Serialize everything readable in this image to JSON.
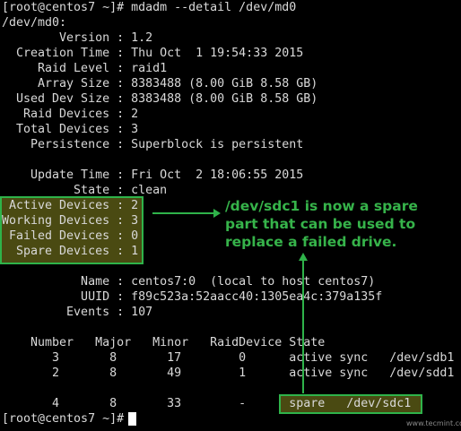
{
  "terminal": {
    "command_line": "[root@centos7 ~]# mdadm --detail /dev/md0",
    "device_line": "/dev/md0:",
    "details": [
      "        Version : 1.2",
      "  Creation Time : Thu Oct  1 19:54:33 2015",
      "     Raid Level : raid1",
      "     Array Size : 8383488 (8.00 GiB 8.58 GB)",
      "  Used Dev Size : 8383488 (8.00 GiB 8.58 GB)",
      "   Raid Devices : 2",
      "  Total Devices : 3",
      "    Persistence : Superblock is persistent",
      "",
      "    Update Time : Fri Oct  2 18:06:55 2015",
      "          State : clean"
    ],
    "device_counts": [
      " Active Devices : 2",
      "Working Devices : 3",
      " Failed Devices : 0",
      "  Spare Devices : 1"
    ],
    "identity": [
      "           Name : centos7:0  (local to host centos7)",
      "           UUID : f89c523a:52aacc40:1305ea4c:379a135f",
      "         Events : 107"
    ],
    "table_header": "    Number   Major   Minor   RaidDevice State",
    "table_rows": [
      "       3       8       17        0      active sync   /dev/sdb1",
      "       2       8       49        1      active sync   /dev/sdd1",
      "",
      "       4       8       33        -      spare   /dev/sdc1"
    ],
    "final_prompt": "[root@centos7 ~]# "
  },
  "annotation": {
    "text": "/dev/sdc1 is now a spare\npart that can be used to\nreplace a failed drive.",
    "color": "#36b34a"
  },
  "spare_highlight_text": "spare   /dev/sdc1",
  "watermark": "www.tecmint.com",
  "colors": {
    "background": "#000000",
    "text": "#d9d9d9",
    "highlight_fill": "#4a4a12",
    "highlight_border": "#2fb34a"
  }
}
